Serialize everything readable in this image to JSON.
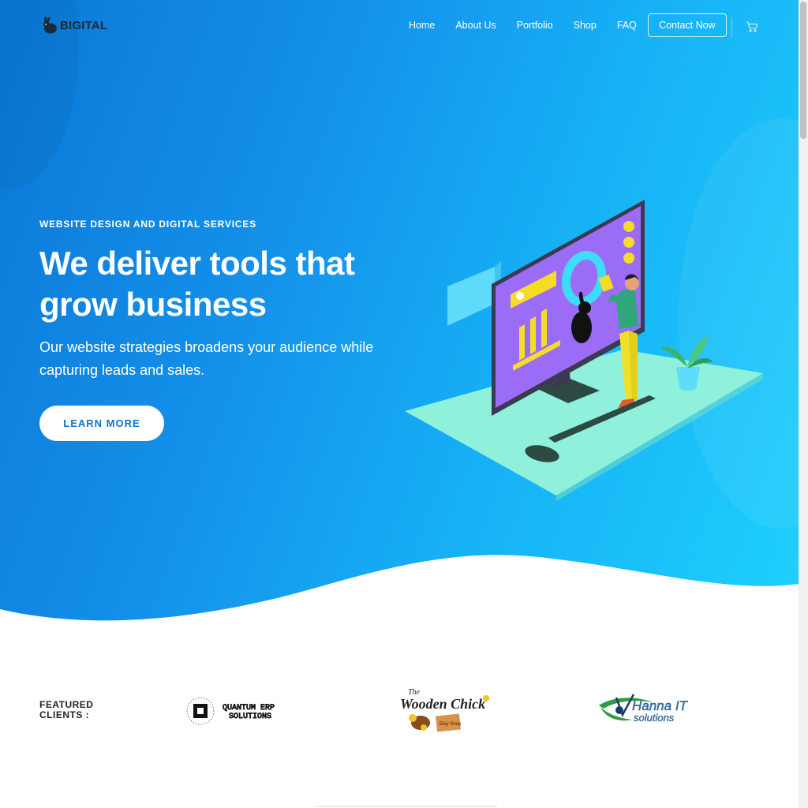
{
  "header": {
    "logo_text": "BIGITAL",
    "nav": [
      "Home",
      "About Us",
      "Portfolio",
      "Shop",
      "FAQ"
    ],
    "cta_label": "Contact Now",
    "cart_icon": "cart-icon"
  },
  "hero": {
    "eyebrow": "WEBSITE DESIGN AND DIGITAL SERVICES",
    "headline": "We deliver tools that grow business",
    "subline": "Our website strategies broadens your audience while capturing leads and sales.",
    "button_label": "LEARN MORE"
  },
  "clients": {
    "label": "FEATURED CLIENTS :",
    "logos": [
      {
        "line1": "QUANTUM ERP",
        "line2": "SOLUTIONS"
      },
      {
        "line1": "The",
        "line2": "Wooden Chick",
        "sign": "Etsy Shop"
      },
      {
        "line1": "Hanna IT",
        "line2": "solutions"
      }
    ]
  },
  "colors": {
    "hero_start": "#0a77d6",
    "hero_end": "#1ed0fc",
    "button_text": "#0e72c9"
  }
}
